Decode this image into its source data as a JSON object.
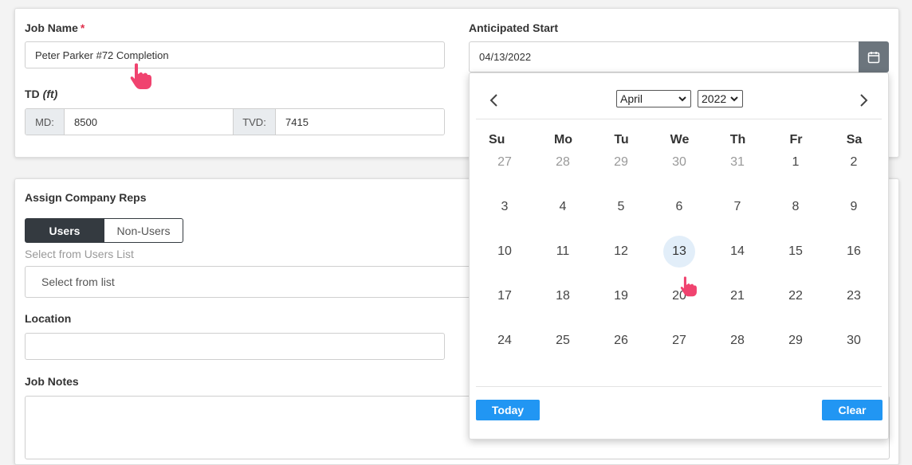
{
  "job_name": {
    "label": "Job Name",
    "required_mark": "*",
    "value": "Peter Parker #72 Completion"
  },
  "td": {
    "label": "TD",
    "unit": "(ft)",
    "md_label": "MD:",
    "md_value": "8500",
    "tvd_label": "TVD:",
    "tvd_value": "7415"
  },
  "anticipated_start": {
    "label": "Anticipated Start",
    "value": "04/13/2022",
    "button_icon": "calendar-icon"
  },
  "company_reps": {
    "label": "Assign Company Reps",
    "tab_users": "Users",
    "tab_non_users": "Non-Users",
    "help": "Select from Users List",
    "select_placeholder": "Select from list"
  },
  "location": {
    "label": "Location",
    "value": ""
  },
  "job_notes": {
    "label": "Job Notes",
    "value": ""
  },
  "datepicker": {
    "month": "April",
    "year": "2022",
    "weekdays": [
      "Su",
      "Mo",
      "Tu",
      "We",
      "Th",
      "Fr",
      "Sa"
    ],
    "days": [
      [
        27,
        28,
        29,
        30,
        31,
        1,
        2
      ],
      [
        3,
        4,
        5,
        6,
        7,
        8,
        9
      ],
      [
        10,
        11,
        12,
        13,
        14,
        15,
        16
      ],
      [
        17,
        18,
        19,
        20,
        21,
        22,
        23
      ],
      [
        24,
        25,
        26,
        27,
        28,
        29,
        30
      ]
    ],
    "outside_month_count_first_row": 5,
    "selected_day": 13,
    "today_label": "Today",
    "clear_label": "Clear"
  },
  "colors": {
    "accent": "#2196f3",
    "dark": "#343a40",
    "required": "#e0314d",
    "cursor": "#f0436f",
    "selected_day_bg": "#e2eef9"
  }
}
